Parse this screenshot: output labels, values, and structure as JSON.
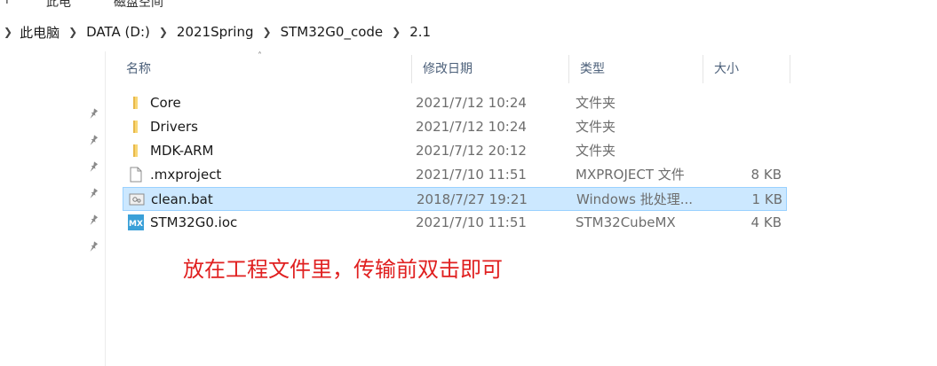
{
  "top_strip": {
    "fragments": [
      "↑",
      "此电",
      "磁盘空间"
    ]
  },
  "address_bar": {
    "breadcrumbs": [
      "此电脑",
      "DATA (D:)",
      "2021Spring",
      "STM32G0_code",
      "2.1"
    ]
  },
  "columns": {
    "name": "名称",
    "date": "修改日期",
    "type": "类型",
    "size": "大小"
  },
  "files": [
    {
      "name": "Core",
      "date": "2021/7/12 10:24",
      "type": "文件夹",
      "size": "",
      "icon": "folder-icon"
    },
    {
      "name": "Drivers",
      "date": "2021/7/12 10:24",
      "type": "文件夹",
      "size": "",
      "icon": "folder-icon"
    },
    {
      "name": "MDK-ARM",
      "date": "2021/7/12 20:12",
      "type": "文件夹",
      "size": "",
      "icon": "folder-icon"
    },
    {
      "name": ".mxproject",
      "date": "2021/7/10 11:51",
      "type": "MXPROJECT 文件",
      "size": "8 KB",
      "icon": "document-icon"
    },
    {
      "name": "clean.bat",
      "date": "2018/7/27 19:21",
      "type": "Windows 批处理...",
      "size": "1 KB",
      "icon": "batch-file-icon",
      "selected": true
    },
    {
      "name": "STM32G0.ioc",
      "date": "2021/7/10 11:51",
      "type": "STM32CubeMX",
      "size": "4 KB",
      "icon": "stm32cubemx-icon",
      "icon_text": "MX"
    }
  ],
  "annotation": {
    "text": "放在工程文件里，传输前双击即可",
    "color": "#e02020"
  },
  "colors": {
    "selection_bg": "#cce8ff",
    "selection_border": "#99d1ff",
    "folder": "#f8d775"
  }
}
